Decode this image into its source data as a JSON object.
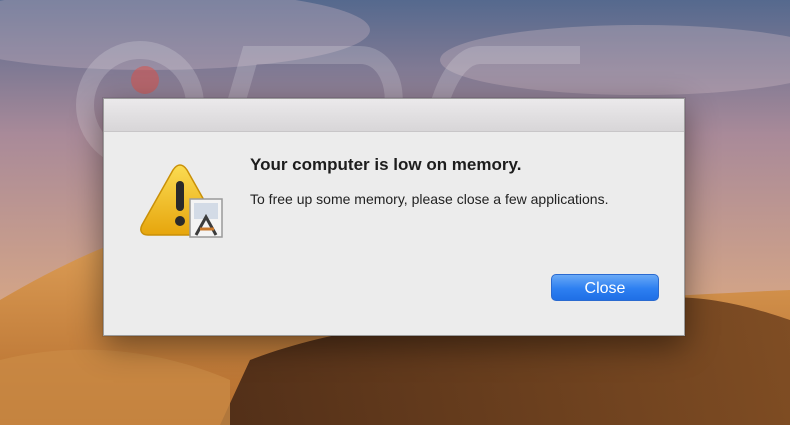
{
  "desktop": {
    "wallpaper_name": "macos-mojave-desert",
    "watermark_text": "PCrisk.com"
  },
  "dialog": {
    "title": "Your computer is low on memory.",
    "message": "To free up some memory, please close a few applications.",
    "icon": "warning-triangle-icon",
    "badge_icon": "app-store-icon",
    "close_label": "Close",
    "accent_color": "#2d7ff1",
    "warning_color": "#f2c21b"
  }
}
